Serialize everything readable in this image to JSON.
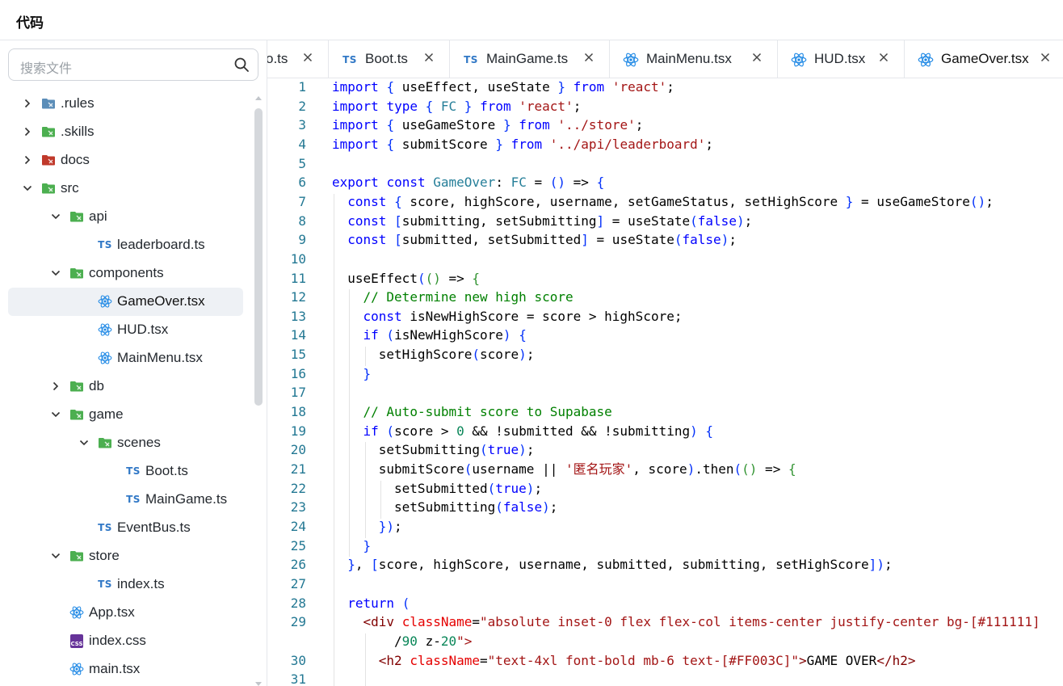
{
  "header": {
    "title": "代码"
  },
  "sidebar": {
    "search_placeholder": "搜索文件",
    "tree": [
      {
        "label": ".rules",
        "kind": "folder",
        "expanded": false,
        "depth": 0
      },
      {
        "label": ".skills",
        "kind": "folder",
        "expanded": false,
        "depth": 0
      },
      {
        "label": "docs",
        "kind": "folder",
        "expanded": false,
        "depth": 0
      },
      {
        "label": "src",
        "kind": "folder",
        "expanded": true,
        "depth": 0
      },
      {
        "label": "api",
        "kind": "folder",
        "expanded": true,
        "depth": 1
      },
      {
        "label": "leaderboard.ts",
        "kind": "ts",
        "depth": 2
      },
      {
        "label": "components",
        "kind": "folder",
        "expanded": true,
        "depth": 1
      },
      {
        "label": "GameOver.tsx",
        "kind": "tsx",
        "depth": 2,
        "selected": true
      },
      {
        "label": "HUD.tsx",
        "kind": "tsx",
        "depth": 2
      },
      {
        "label": "MainMenu.tsx",
        "kind": "tsx",
        "depth": 2
      },
      {
        "label": "db",
        "kind": "folder",
        "expanded": false,
        "depth": 1
      },
      {
        "label": "game",
        "kind": "folder",
        "expanded": true,
        "depth": 1
      },
      {
        "label": "scenes",
        "kind": "folder",
        "expanded": true,
        "depth": 2
      },
      {
        "label": "Boot.ts",
        "kind": "ts",
        "depth": 3
      },
      {
        "label": "MainGame.ts",
        "kind": "ts",
        "depth": 3
      },
      {
        "label": "EventBus.ts",
        "kind": "ts",
        "depth": 2
      },
      {
        "label": "store",
        "kind": "folder",
        "expanded": true,
        "depth": 1
      },
      {
        "label": "index.ts",
        "kind": "ts",
        "depth": 2
      },
      {
        "label": "App.tsx",
        "kind": "tsx",
        "depth": 1
      },
      {
        "label": "index.css",
        "kind": "css",
        "depth": 1
      },
      {
        "label": "main.tsx",
        "kind": "tsx",
        "depth": 1
      }
    ]
  },
  "tabs": [
    {
      "label": "o.ts",
      "kind": "partial"
    },
    {
      "label": "Boot.ts",
      "kind": "ts"
    },
    {
      "label": "MainGame.ts",
      "kind": "ts"
    },
    {
      "label": "MainMenu.tsx",
      "kind": "tsx"
    },
    {
      "label": "HUD.tsx",
      "kind": "tsx"
    },
    {
      "label": "GameOver.tsx",
      "kind": "tsx",
      "active": true
    }
  ],
  "editor": {
    "lines": [
      {
        "n": "1",
        "indent": 0,
        "text": "import { useEffect, useState } from 'react';"
      },
      {
        "n": "2",
        "indent": 0,
        "text": "import type { FC } from 'react';"
      },
      {
        "n": "3",
        "indent": 0,
        "text": "import { useGameStore } from '../store';"
      },
      {
        "n": "4",
        "indent": 0,
        "text": "import { submitScore } from '../api/leaderboard';"
      },
      {
        "n": "5",
        "indent": 0,
        "text": ""
      },
      {
        "n": "6",
        "indent": 0,
        "text": "export const GameOver: FC = () => {"
      },
      {
        "n": "7",
        "indent": 1,
        "text": "const { score, highScore, username, setGameStatus, setHighScore } = useGameStore();"
      },
      {
        "n": "8",
        "indent": 1,
        "text": "const [submitting, setSubmitting] = useState(false);"
      },
      {
        "n": "9",
        "indent": 1,
        "text": "const [submitted, setSubmitted] = useState(false);"
      },
      {
        "n": "10",
        "indent": 0,
        "text": ""
      },
      {
        "n": "11",
        "indent": 1,
        "text": "useEffect(() => {"
      },
      {
        "n": "12",
        "indent": 2,
        "text": "// Determine new high score"
      },
      {
        "n": "13",
        "indent": 2,
        "text": "const isNewHighScore = score > highScore;"
      },
      {
        "n": "14",
        "indent": 2,
        "text": "if (isNewHighScore) {"
      },
      {
        "n": "15",
        "indent": 3,
        "text": "setHighScore(score);"
      },
      {
        "n": "16",
        "indent": 2,
        "text": "}"
      },
      {
        "n": "17",
        "indent": 0,
        "text": ""
      },
      {
        "n": "18",
        "indent": 2,
        "text": "// Auto-submit score to Supabase"
      },
      {
        "n": "19",
        "indent": 2,
        "text": "if (score > 0 && !submitted && !submitting) {"
      },
      {
        "n": "20",
        "indent": 3,
        "text": "setSubmitting(true);"
      },
      {
        "n": "21",
        "indent": 3,
        "text": "submitScore(username || '匿名玩家', score).then(() => {"
      },
      {
        "n": "22",
        "indent": 4,
        "text": "setSubmitted(true);"
      },
      {
        "n": "23",
        "indent": 4,
        "text": "setSubmitting(false);"
      },
      {
        "n": "24",
        "indent": 3,
        "text": "});"
      },
      {
        "n": "25",
        "indent": 2,
        "text": "}"
      },
      {
        "n": "26",
        "indent": 1,
        "text": "}, [score, highScore, username, submitted, submitting, setHighScore]);"
      },
      {
        "n": "27",
        "indent": 0,
        "text": ""
      },
      {
        "n": "28",
        "indent": 1,
        "text": "return ("
      },
      {
        "n": "29",
        "indent": 2,
        "text": "<div className=\"absolute inset-0 flex flex-col items-center justify-center bg-[#111111]"
      },
      {
        "n": "",
        "indent": 4,
        "text": "/90 z-20\">"
      },
      {
        "n": "30",
        "indent": 3,
        "text": "<h2 className=\"text-4xl font-bold mb-6 text-[#FF003C]\">GAME OVER</h2>"
      },
      {
        "n": "31",
        "indent": 0,
        "text": ""
      }
    ]
  },
  "colors": {
    "keyword": "#0000ff",
    "string": "#a31515",
    "comment": "#008000",
    "type": "#267f99",
    "line_number": "#237893",
    "ts_badge": "#3178c6",
    "react_icon": "#1e88e5",
    "folder_green": "#4caf50",
    "selected_row": "#eef1f5"
  }
}
